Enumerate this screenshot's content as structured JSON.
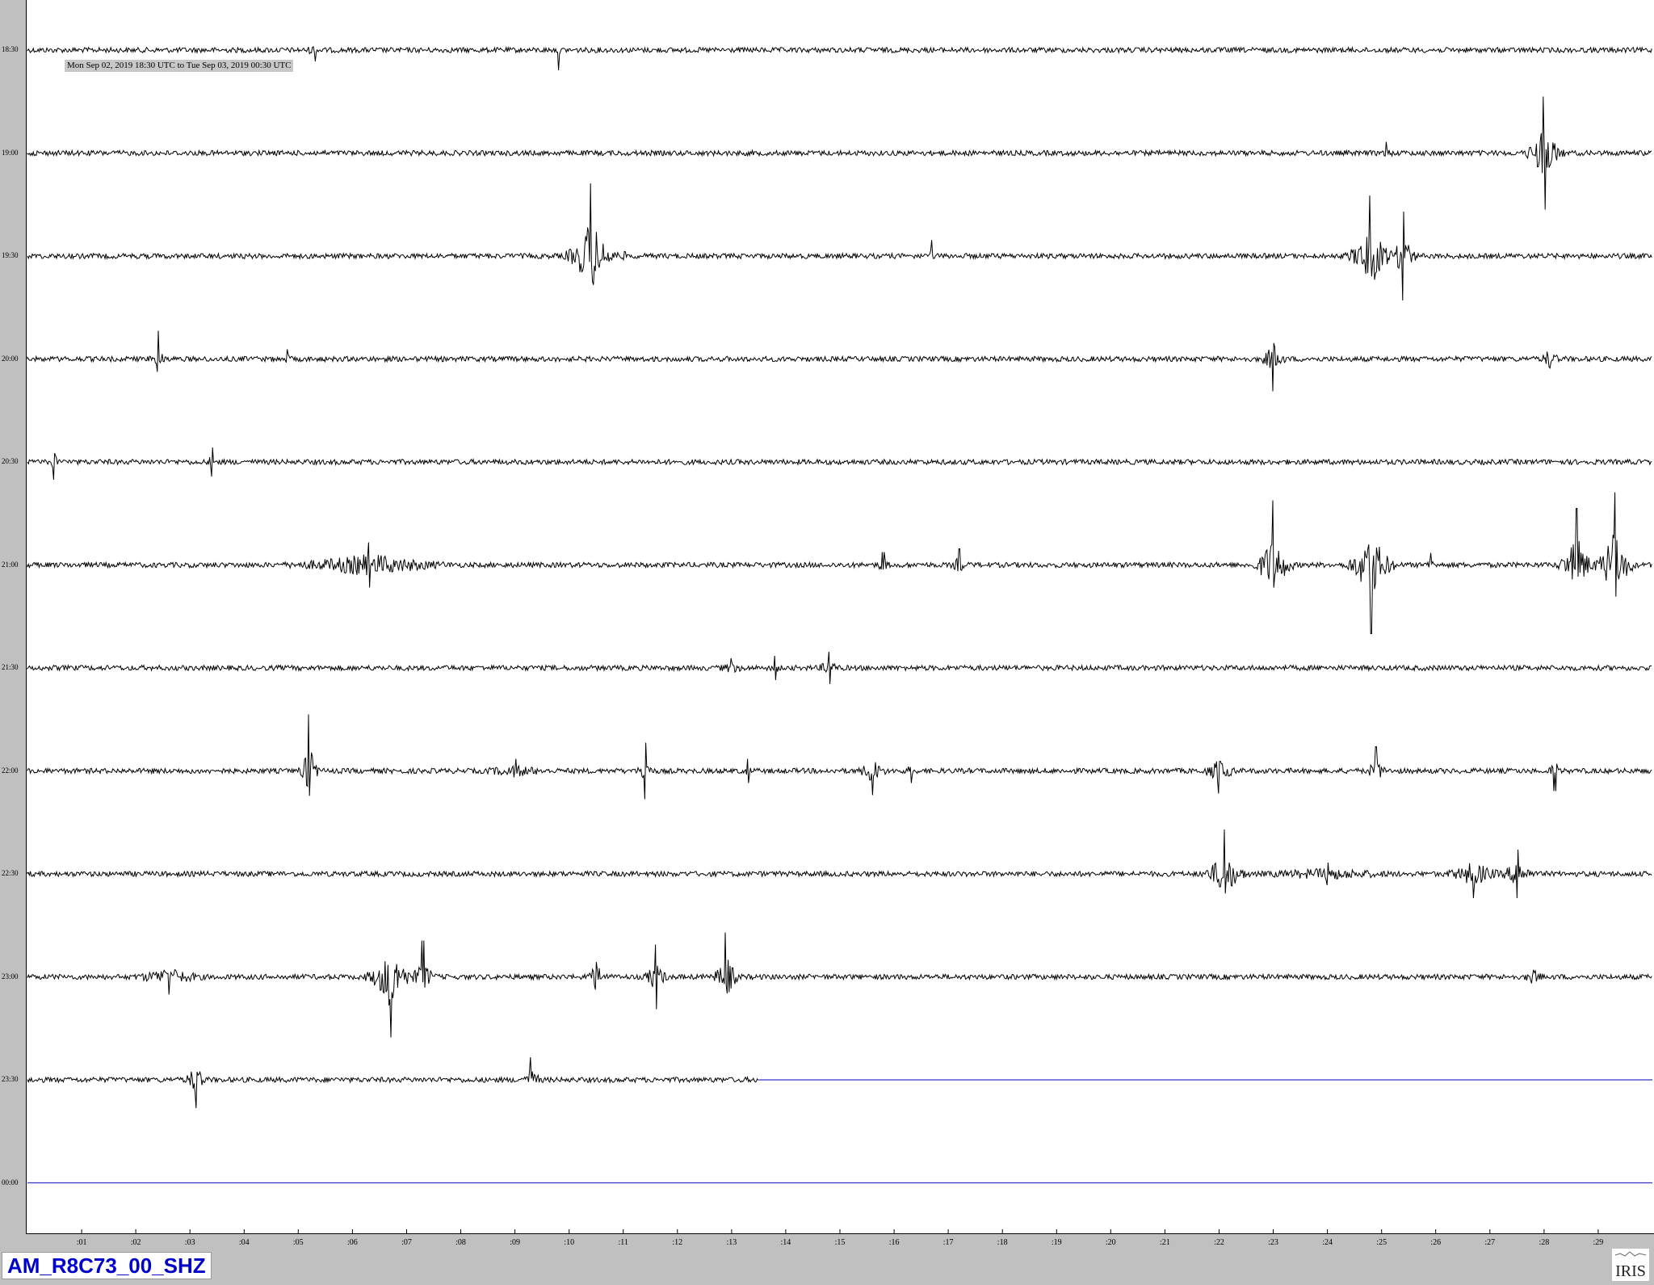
{
  "header": {
    "date_range": "Mon Sep 02, 2019 18:30 UTC to Tue Sep 03, 2019 00:30 UTC"
  },
  "footer": {
    "station": "AM_R8C73_00_SHZ",
    "logo_text": "IRIS"
  },
  "colors": {
    "trace": "#000000",
    "no_data_line": "#3333cc",
    "station_text": "#0000cc",
    "frame_gray": "#c0c0c0"
  },
  "chart_data": {
    "type": "line",
    "subtype": "helicorder",
    "x_unit": "minutes past row start",
    "xlim": [
      0,
      30
    ],
    "tick_labels": [
      ":01",
      ":02",
      ":03",
      ":04",
      ":05",
      ":06",
      ":07",
      ":08",
      ":09",
      ":10",
      ":11",
      ":12",
      ":13",
      ":14",
      ":15",
      ":16",
      ":17",
      ":18",
      ":19",
      ":20",
      ":21",
      ":22",
      ":23",
      ":24",
      ":25",
      ":26",
      ":27",
      ":28",
      ":29"
    ],
    "rows": [
      {
        "label": "18:30",
        "data_until": 30,
        "bursts": [
          {
            "t": 5.3,
            "amp": 14,
            "dur": 0.4
          },
          {
            "t": 9.8,
            "amp": 25,
            "dur": 0.05
          }
        ]
      },
      {
        "label": "19:00",
        "data_until": 30,
        "bursts": [
          {
            "t": 25.1,
            "amp": 14,
            "dur": 0.3
          },
          {
            "t": 28.0,
            "amp": 70,
            "dur": 0.4
          }
        ]
      },
      {
        "label": "19:30",
        "data_until": 30,
        "bursts": [
          {
            "t": 10.4,
            "amp": 90,
            "dur": 0.5
          },
          {
            "t": 11.0,
            "amp": 15,
            "dur": 0.2
          },
          {
            "t": 16.7,
            "amp": 20,
            "dur": 0.1
          },
          {
            "t": 24.8,
            "amp": 75,
            "dur": 0.5
          },
          {
            "t": 25.4,
            "amp": 55,
            "dur": 0.3
          }
        ]
      },
      {
        "label": "20:00",
        "data_until": 30,
        "bursts": [
          {
            "t": 2.4,
            "amp": 35,
            "dur": 0.2
          },
          {
            "t": 4.8,
            "amp": 12,
            "dur": 0.3
          },
          {
            "t": 23.0,
            "amp": 40,
            "dur": 0.3
          },
          {
            "t": 28.1,
            "amp": 25,
            "dur": 0.3
          }
        ]
      },
      {
        "label": "20:30",
        "data_until": 30,
        "bursts": [
          {
            "t": 0.5,
            "amp": 22,
            "dur": 0.2
          },
          {
            "t": 3.4,
            "amp": 18,
            "dur": 0.2
          }
        ]
      },
      {
        "label": "21:00",
        "data_until": 30,
        "bursts": [
          {
            "t": 6.3,
            "amp": 28,
            "dur": 2.4
          },
          {
            "t": 15.8,
            "amp": 16,
            "dur": 0.3
          },
          {
            "t": 17.2,
            "amp": 20,
            "dur": 0.3
          },
          {
            "t": 23.0,
            "amp": 80,
            "dur": 0.4
          },
          {
            "t": 24.8,
            "amp": 85,
            "dur": 0.5
          },
          {
            "t": 25.9,
            "amp": 15,
            "dur": 0.2
          },
          {
            "t": 28.6,
            "amp": 70,
            "dur": 0.4
          },
          {
            "t": 29.3,
            "amp": 90,
            "dur": 0.4
          }
        ]
      },
      {
        "label": "21:30",
        "data_until": 30,
        "bursts": [
          {
            "t": 13.0,
            "amp": 12,
            "dur": 0.8
          },
          {
            "t": 13.8,
            "amp": 15,
            "dur": 0.2
          },
          {
            "t": 14.8,
            "amp": 20,
            "dur": 0.4
          }
        ]
      },
      {
        "label": "22:00",
        "data_until": 30,
        "bursts": [
          {
            "t": 5.2,
            "amp": 70,
            "dur": 0.2
          },
          {
            "t": 9.0,
            "amp": 15,
            "dur": 1.5
          },
          {
            "t": 11.4,
            "amp": 35,
            "dur": 0.2
          },
          {
            "t": 13.3,
            "amp": 15,
            "dur": 0.2
          },
          {
            "t": 15.6,
            "amp": 30,
            "dur": 0.4
          },
          {
            "t": 16.3,
            "amp": 15,
            "dur": 0.2
          },
          {
            "t": 22.0,
            "amp": 28,
            "dur": 0.5
          },
          {
            "t": 24.9,
            "amp": 30,
            "dur": 0.3
          },
          {
            "t": 28.2,
            "amp": 25,
            "dur": 0.2
          }
        ]
      },
      {
        "label": "22:30",
        "data_until": 30,
        "bursts": [
          {
            "t": 22.1,
            "amp": 55,
            "dur": 0.5
          },
          {
            "t": 24.0,
            "amp": 14,
            "dur": 3.5
          },
          {
            "t": 26.7,
            "amp": 30,
            "dur": 0.8
          },
          {
            "t": 27.5,
            "amp": 30,
            "dur": 0.5
          }
        ]
      },
      {
        "label": "23:00",
        "data_until": 30,
        "bursts": [
          {
            "t": 2.6,
            "amp": 22,
            "dur": 1.2
          },
          {
            "t": 6.7,
            "amp": 75,
            "dur": 0.5
          },
          {
            "t": 7.3,
            "amp": 45,
            "dur": 0.3
          },
          {
            "t": 10.5,
            "amp": 35,
            "dur": 0.3
          },
          {
            "t": 11.6,
            "amp": 40,
            "dur": 0.3
          },
          {
            "t": 12.9,
            "amp": 55,
            "dur": 0.3
          },
          {
            "t": 27.8,
            "amp": 18,
            "dur": 0.4
          }
        ]
      },
      {
        "label": "23:30",
        "data_until": 13.5,
        "bursts": [
          {
            "t": 3.1,
            "amp": 35,
            "dur": 0.3
          },
          {
            "t": 9.3,
            "amp": 28,
            "dur": 0.3
          }
        ]
      },
      {
        "label": "00:00",
        "data_until": 0,
        "bursts": []
      }
    ]
  }
}
